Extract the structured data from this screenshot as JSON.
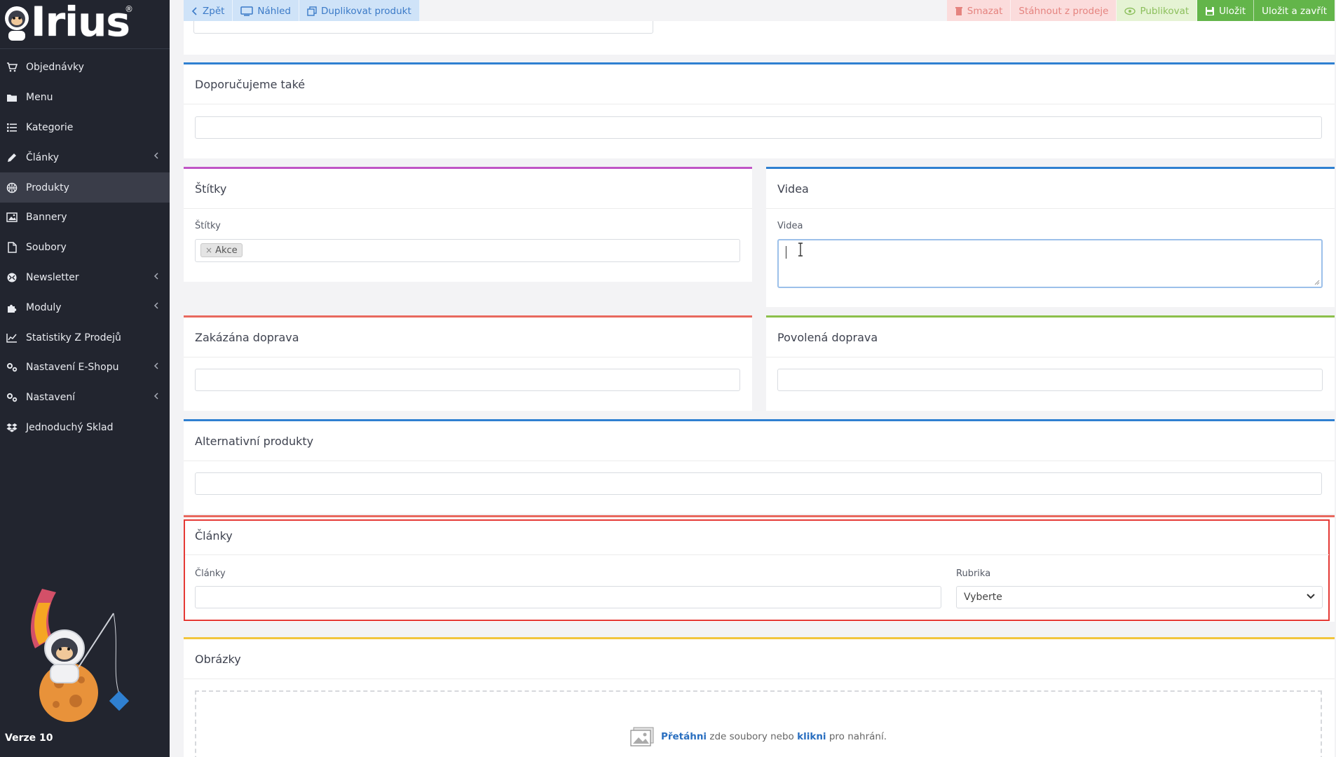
{
  "brand": {
    "logo_text": "Irius",
    "reg_mark": "®",
    "version": "Verze 10"
  },
  "sidebar": {
    "items": [
      {
        "label": "Objednávky",
        "icon": "cart-icon",
        "chevron": false,
        "active": false
      },
      {
        "label": "Menu",
        "icon": "folder-icon",
        "chevron": false,
        "active": false
      },
      {
        "label": "Kategorie",
        "icon": "list-icon",
        "chevron": false,
        "active": false
      },
      {
        "label": "Články",
        "icon": "pencil-icon",
        "chevron": true,
        "active": false
      },
      {
        "label": "Produkty",
        "icon": "basketball-icon",
        "chevron": false,
        "active": true
      },
      {
        "label": "Bannery",
        "icon": "image-icon",
        "chevron": false,
        "active": false
      },
      {
        "label": "Soubory",
        "icon": "file-icon",
        "chevron": false,
        "active": false
      },
      {
        "label": "Newsletter",
        "icon": "globe-icon",
        "chevron": true,
        "active": false
      },
      {
        "label": "Moduly",
        "icon": "puzzle-icon",
        "chevron": true,
        "active": false
      },
      {
        "label": "Statistiky Z Prodejů",
        "icon": "chart-icon",
        "chevron": false,
        "active": false
      },
      {
        "label": "Nastavení E-Shopu",
        "icon": "cogs-icon",
        "chevron": true,
        "active": false
      },
      {
        "label": "Nastavení",
        "icon": "cogs-icon",
        "chevron": true,
        "active": false
      },
      {
        "label": "Jednoduchý Sklad",
        "icon": "dropbox-icon",
        "chevron": false,
        "active": false
      }
    ]
  },
  "toolbar": {
    "back": "Zpět",
    "preview": "Náhled",
    "duplicate": "Duplikovat produkt",
    "delete": "Smazat",
    "withdraw": "Stáhnout z prodeje",
    "publish": "Publikovat",
    "save": "Uložit",
    "save_close": "Uložit a zavřít"
  },
  "panels": {
    "recommended": {
      "title": "Doporučujeme také"
    },
    "tags": {
      "title": "Štítky",
      "label": "Štítky",
      "tag": "Akce"
    },
    "videos": {
      "title": "Videa",
      "label": "Videa"
    },
    "forbidden_shipping": {
      "title": "Zakázána doprava"
    },
    "allowed_shipping": {
      "title": "Povolená doprava"
    },
    "alternative": {
      "title": "Alternativní produkty"
    },
    "articles": {
      "title": "Články",
      "label": "Články",
      "category_label": "Rubrika",
      "category_value": "Vyberte"
    },
    "images": {
      "title": "Obrázky",
      "drop_bold1": "Přetáhni",
      "drop_mid": " zde soubory nebo ",
      "drop_bold2": "klikni",
      "drop_end": " pro nahrání."
    }
  },
  "colors": {
    "sidebar_bg": "#22252f",
    "blue": "#2f80d1",
    "pink": "#c055c6",
    "red": "#e8685e",
    "green": "#8cc04b",
    "yellow": "#f2c53d",
    "highlight": "#e53935"
  }
}
